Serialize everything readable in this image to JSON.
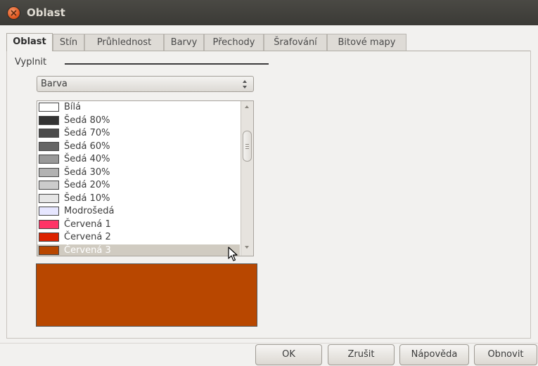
{
  "window": {
    "title": "Oblast"
  },
  "tabs": [
    {
      "label": "Oblast",
      "active": true
    },
    {
      "label": "Stín"
    },
    {
      "label": "Průhlednost"
    },
    {
      "label": "Barvy"
    },
    {
      "label": "Přechody"
    },
    {
      "label": "Šrafování"
    },
    {
      "label": "Bitové mapy"
    }
  ],
  "fill": {
    "group_label": "Vyplnit",
    "type_select": {
      "value": "Barva"
    },
    "colors": [
      {
        "name": "Bílá",
        "color": "#ffffff"
      },
      {
        "name": "Šedá 80%",
        "color": "#333333"
      },
      {
        "name": "Šedá 70%",
        "color": "#4c4c4c"
      },
      {
        "name": "Šedá 60%",
        "color": "#666666"
      },
      {
        "name": "Šedá 40%",
        "color": "#999999"
      },
      {
        "name": "Šedá 30%",
        "color": "#b2b2b2"
      },
      {
        "name": "Šedá 20%",
        "color": "#cccccc"
      },
      {
        "name": "Šedá 10%",
        "color": "#e6e6e6"
      },
      {
        "name": "Modrošedá",
        "color": "#e6e6ff"
      },
      {
        "name": "Červená 1",
        "color": "#ff3366"
      },
      {
        "name": "Červená 2",
        "color": "#dc2300"
      },
      {
        "name": "Červená 3",
        "color": "#b84700",
        "selected": true
      }
    ],
    "preview_color": "#b84700"
  },
  "buttons": {
    "ok": "OK",
    "cancel": "Zrušit",
    "help": "Nápověda",
    "reset": "Obnovit"
  }
}
